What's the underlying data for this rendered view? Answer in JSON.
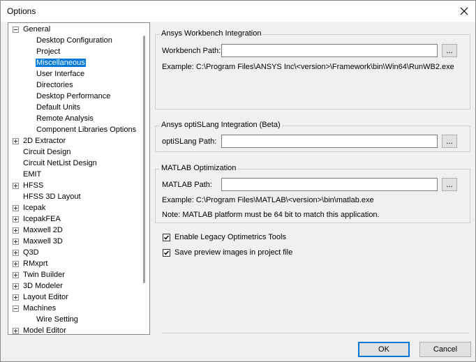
{
  "window": {
    "title": "Options"
  },
  "tree": {
    "items": [
      {
        "label": "General",
        "expander": "minus",
        "depth": 0
      },
      {
        "label": "Desktop Configuration",
        "expander": null,
        "depth": 1
      },
      {
        "label": "Project",
        "expander": null,
        "depth": 1
      },
      {
        "label": "Miscellaneous",
        "expander": null,
        "depth": 1,
        "selected": true
      },
      {
        "label": "User Interface",
        "expander": null,
        "depth": 1
      },
      {
        "label": "Directories",
        "expander": null,
        "depth": 1
      },
      {
        "label": "Desktop Performance",
        "expander": null,
        "depth": 1
      },
      {
        "label": "Default Units",
        "expander": null,
        "depth": 1
      },
      {
        "label": "Remote Analysis",
        "expander": null,
        "depth": 1
      },
      {
        "label": "Component Libraries Options",
        "expander": null,
        "depth": 1
      },
      {
        "label": "2D Extractor",
        "expander": "plus",
        "depth": 0
      },
      {
        "label": "Circuit Design",
        "expander": null,
        "depth": 0
      },
      {
        "label": "Circuit NetList Design",
        "expander": null,
        "depth": 0
      },
      {
        "label": "EMIT",
        "expander": null,
        "depth": 0
      },
      {
        "label": "HFSS",
        "expander": "plus",
        "depth": 0
      },
      {
        "label": "HFSS 3D Layout",
        "expander": null,
        "depth": 0
      },
      {
        "label": "Icepak",
        "expander": "plus",
        "depth": 0
      },
      {
        "label": "IcepakFEA",
        "expander": "plus",
        "depth": 0
      },
      {
        "label": "Maxwell 2D",
        "expander": "plus",
        "depth": 0
      },
      {
        "label": "Maxwell 3D",
        "expander": "plus",
        "depth": 0
      },
      {
        "label": "Q3D",
        "expander": "plus",
        "depth": 0
      },
      {
        "label": "RMxprt",
        "expander": "plus",
        "depth": 0
      },
      {
        "label": "Twin Builder",
        "expander": "plus",
        "depth": 0
      },
      {
        "label": "3D Modeler",
        "expander": "plus",
        "depth": 0
      },
      {
        "label": "Layout Editor",
        "expander": "plus",
        "depth": 0
      },
      {
        "label": "Machines",
        "expander": "minus",
        "depth": 0
      },
      {
        "label": "Wire Setting",
        "expander": null,
        "depth": 1
      },
      {
        "label": "Model Editor",
        "expander": "plus",
        "depth": 0
      }
    ]
  },
  "workbench": {
    "title": "Ansys Workbench Integration",
    "path_label": "Workbench Path:",
    "path_value": "",
    "browse_label": "...",
    "example": "Example: C:\\Program Files\\ANSYS Inc\\<version>\\Framework\\bin\\Win64\\RunWB2.exe"
  },
  "optislang": {
    "title": "Ansys optiSLang Integration (Beta)",
    "path_label": "optiSLang Path:",
    "path_value": "",
    "browse_label": "..."
  },
  "matlab": {
    "title": "MATLAB Optimization",
    "path_label": "MATLAB Path:",
    "path_value": "",
    "browse_label": "...",
    "example": "Example: C:\\Program Files\\MATLAB\\<version>\\bin\\matlab.exe",
    "note": "Note: MATLAB platform must be 64 bit to match this application."
  },
  "options": {
    "legacy_optimetrics": {
      "label": "Enable Legacy Optimetrics Tools",
      "checked": true
    },
    "save_preview": {
      "label": "Save preview images in project file",
      "checked": true
    }
  },
  "buttons": {
    "ok": "OK",
    "cancel": "Cancel"
  }
}
